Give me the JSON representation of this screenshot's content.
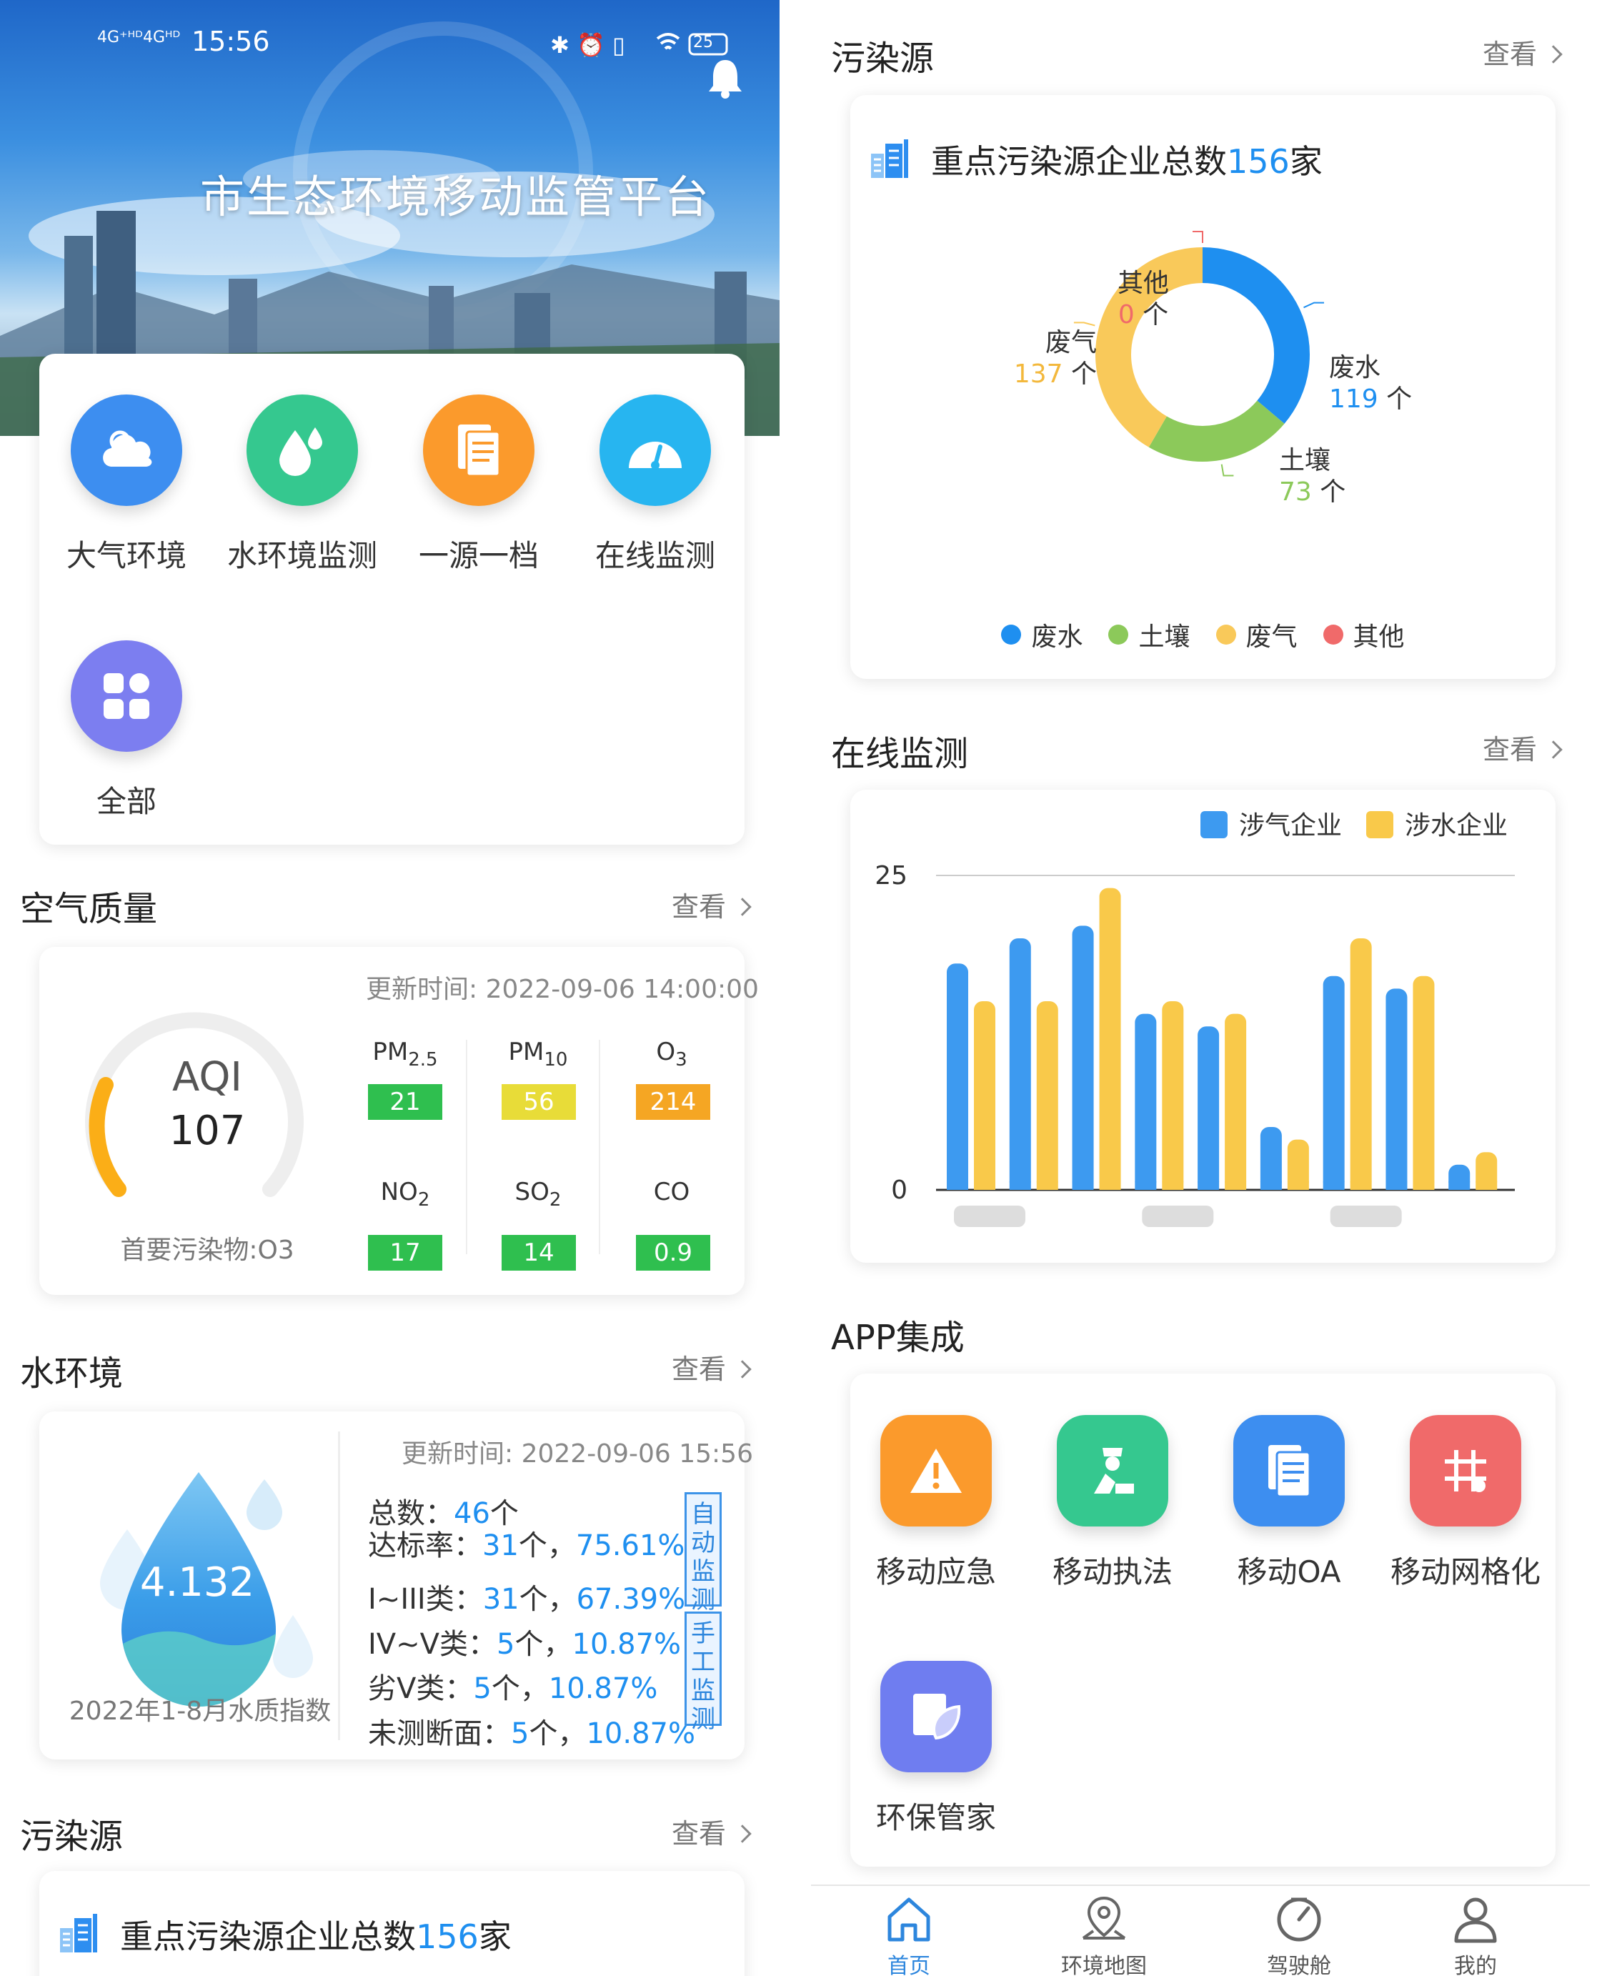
{
  "status_bar": {
    "net1": "4G⁺ᴴᴰ",
    "net2": "4Gᴴᴰ",
    "time": "15:56",
    "battery": "25"
  },
  "header": {
    "title": "市生态环境移动监管平台"
  },
  "quick_menu": [
    {
      "label": "大气环境",
      "icon": "cloud-icon",
      "color": "#3d8ef0"
    },
    {
      "label": "水环境监测",
      "icon": "water-drop-icon",
      "color": "#35c88f"
    },
    {
      "label": "一源一档",
      "icon": "document-icon",
      "color": "#fb9a2c"
    },
    {
      "label": "在线监测",
      "icon": "gauge-icon",
      "color": "#27b5f0"
    },
    {
      "label": "全部",
      "icon": "grid-icon",
      "color": "#7c7ef0"
    }
  ],
  "air": {
    "title": "空气质量",
    "more": "查看",
    "update": "更新时间: 2022-09-06 14:00:00",
    "aqi_label": "AQI",
    "aqi_value": "107",
    "primary": "首要污染物:O3",
    "pollutants": [
      {
        "name": "PM",
        "sub": "2.5",
        "value": "21",
        "color": "#2fbf4f"
      },
      {
        "name": "PM",
        "sub": "10",
        "value": "56",
        "color": "#e8dc38"
      },
      {
        "name": "O",
        "sub": "3",
        "value": "214",
        "color": "#f5a623"
      },
      {
        "name": "NO",
        "sub": "2",
        "value": "17",
        "color": "#2fbf4f"
      },
      {
        "name": "SO",
        "sub": "2",
        "value": "14",
        "color": "#2fbf4f"
      },
      {
        "name": "CO",
        "sub": "",
        "value": "0.9",
        "color": "#2fbf4f"
      }
    ]
  },
  "water": {
    "title": "水环境",
    "more": "查看",
    "update": "更新时间: 2022-09-06 15:56",
    "index": "4.132",
    "caption": "2022年1-8月水质指数",
    "l1a": "总数：",
    "l1b": "46",
    "l1c": "个",
    "l2a": "达标率：",
    "l2b": "31",
    "l2c": "个，",
    "l2d": "75.61%",
    "l3a": "I~III类：",
    "l3b": "31",
    "l3c": "个，",
    "l3d": "67.39%",
    "l4a": "IV~V类：",
    "l4b": "5",
    "l4c": "个，",
    "l4d": "10.87%",
    "l5a": "劣V类：",
    "l5b": "5",
    "l5c": "个，",
    "l5d": "10.87%",
    "l6a": "未测断面：",
    "l6b": "5",
    "l6c": "个，",
    "l6d": "10.87%",
    "tag1": [
      "自",
      "动",
      "监",
      "测"
    ],
    "tag2": [
      "手",
      "工",
      "监",
      "测"
    ]
  },
  "pollution": {
    "title": "污染源",
    "more": "查看",
    "headline_pre": "重点污染源企业总数",
    "headline_num": "156",
    "headline_post": "家",
    "unit": "个",
    "legend": [
      "废水",
      "土壤",
      "废气",
      "其他"
    ]
  },
  "online": {
    "title": "在线监测",
    "more": "查看"
  },
  "app_integration": {
    "title": "APP集成",
    "apps": [
      {
        "label": "移动应急",
        "icon": "warning-icon",
        "color": "#fb9a2c"
      },
      {
        "label": "移动执法",
        "icon": "officer-icon",
        "color": "#35c88f"
      },
      {
        "label": "移动OA",
        "icon": "document-icon",
        "color": "#3d8ef0"
      },
      {
        "label": "移动网格化",
        "icon": "hash-grid-icon",
        "color": "#f06a6a"
      },
      {
        "label": "环保管家",
        "icon": "leaf-book-icon",
        "color": "#6f7df0"
      }
    ]
  },
  "bottom_nav": [
    {
      "label": "首页",
      "icon": "home-icon",
      "active": true
    },
    {
      "label": "环境地图",
      "icon": "map-pin-icon",
      "active": false
    },
    {
      "label": "驾驶舱",
      "icon": "dashboard-icon",
      "active": false
    },
    {
      "label": "我的",
      "icon": "user-icon",
      "active": false
    }
  ],
  "chart_data": [
    {
      "type": "pie",
      "title": "重点污染源企业总数156家",
      "categories": [
        "废水",
        "土壤",
        "废气",
        "其他"
      ],
      "values": [
        119,
        73,
        137,
        0
      ],
      "colors": [
        "#1e8ff0",
        "#8cc95a",
        "#f9c95a",
        "#f06a6a"
      ],
      "legend": "bottom"
    },
    {
      "type": "bar",
      "categories": [
        "",
        "",
        "",
        "",
        "",
        "",
        "",
        "",
        ""
      ],
      "series": [
        {
          "name": "涉气企业",
          "values": [
            18,
            20,
            21,
            14,
            13,
            5,
            17,
            16,
            2
          ],
          "color": "#3d9af0"
        },
        {
          "name": "涉水企业",
          "values": [
            15,
            15,
            24,
            15,
            14,
            4,
            20,
            17,
            3
          ],
          "color": "#f9c94a"
        }
      ],
      "ylim": [
        0,
        25
      ],
      "yticks": [
        0,
        25
      ],
      "legend": "top-right"
    }
  ]
}
